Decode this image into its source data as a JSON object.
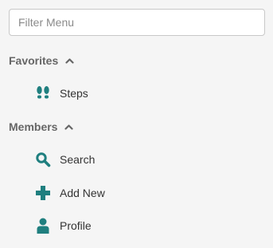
{
  "filter": {
    "placeholder": "Filter Menu",
    "value": ""
  },
  "colors": {
    "accent": "#1f7f7f",
    "section_text": "#666666",
    "item_text": "#333333",
    "background": "#f5f5f5"
  },
  "sections": [
    {
      "title": "Favorites",
      "expanded": true,
      "items": [
        {
          "label": "Steps",
          "icon": "footsteps-icon"
        }
      ]
    },
    {
      "title": "Members",
      "expanded": true,
      "items": [
        {
          "label": "Search",
          "icon": "search-icon"
        },
        {
          "label": "Add New",
          "icon": "plus-icon"
        },
        {
          "label": "Profile",
          "icon": "user-icon"
        }
      ]
    }
  ]
}
